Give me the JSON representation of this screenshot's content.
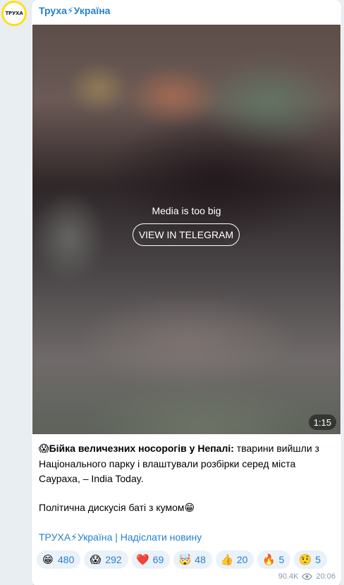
{
  "channel": {
    "name": "Труха⚡Україна",
    "avatar_text": "ТРУХА"
  },
  "media": {
    "notice": "Media is too big",
    "button_label": "VIEW IN TELEGRAM",
    "duration": "1:15"
  },
  "post": {
    "lead_emoji": "😱",
    "headline": "Бійка величезних носорогів у Непалі:",
    "body": " тварини вийшли з Національного парку і влаштували розбірки серед міста Саураха, – India Today.",
    "para2": "Політична дискусія баті з кумом",
    "para2_emoji": "😁",
    "link_channel": "ТРУХА⚡Україна",
    "link_separator": " | ",
    "link_submit": "Надіслати новину"
  },
  "reactions": [
    {
      "emoji": "😁",
      "count": "480"
    },
    {
      "emoji": "😱",
      "count": "292"
    },
    {
      "emoji": "❤️",
      "count": "69"
    },
    {
      "emoji": "🤯",
      "count": "48"
    },
    {
      "emoji": "👍",
      "count": "20"
    },
    {
      "emoji": "🔥",
      "count": "5"
    },
    {
      "emoji": "🤨",
      "count": "5"
    }
  ],
  "meta": {
    "views": "90.4K",
    "time": "20:06"
  },
  "colors": {
    "accent": "#2481cc",
    "avatar_ring": "#ffde17",
    "reaction_bg": "#eaf1f8"
  }
}
